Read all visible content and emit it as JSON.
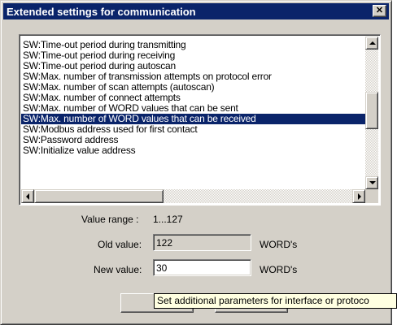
{
  "dialog": {
    "title": "Extended settings for communication",
    "close_glyph": "✕"
  },
  "list": {
    "items": [
      "SW:Time-out period during transmitting",
      "SW:Time-out period during receiving",
      "SW:Time-out period during autoscan",
      "SW:Max. number of transmission attempts on protocol error",
      "SW:Max. number of scan attempts (autoscan)",
      "SW:Max. number of connect attempts",
      "SW:Max. number of WORD values that can be sent",
      "SW:Max. number of WORD values that can be received",
      "SW:Modbus address used for first contact",
      "SW:Password address",
      "SW:Initialize value address"
    ],
    "selected_index": 7
  },
  "value_range": {
    "label": "Value range :",
    "value": "1...127"
  },
  "old_value": {
    "label": "Old value:",
    "value": "122",
    "unit": "WORD's"
  },
  "new_value": {
    "label": "New value:",
    "value": "30",
    "unit": "WORD's"
  },
  "buttons": {
    "ok_label": "O",
    "cancel_label": ""
  },
  "tooltip": {
    "text": "Set additional parameters for interface or protoco"
  },
  "colors": {
    "title_bar": "#0a246a",
    "selection": "#0a246a",
    "face": "#d4d0c8",
    "tooltip_bg": "#ffffe1"
  }
}
